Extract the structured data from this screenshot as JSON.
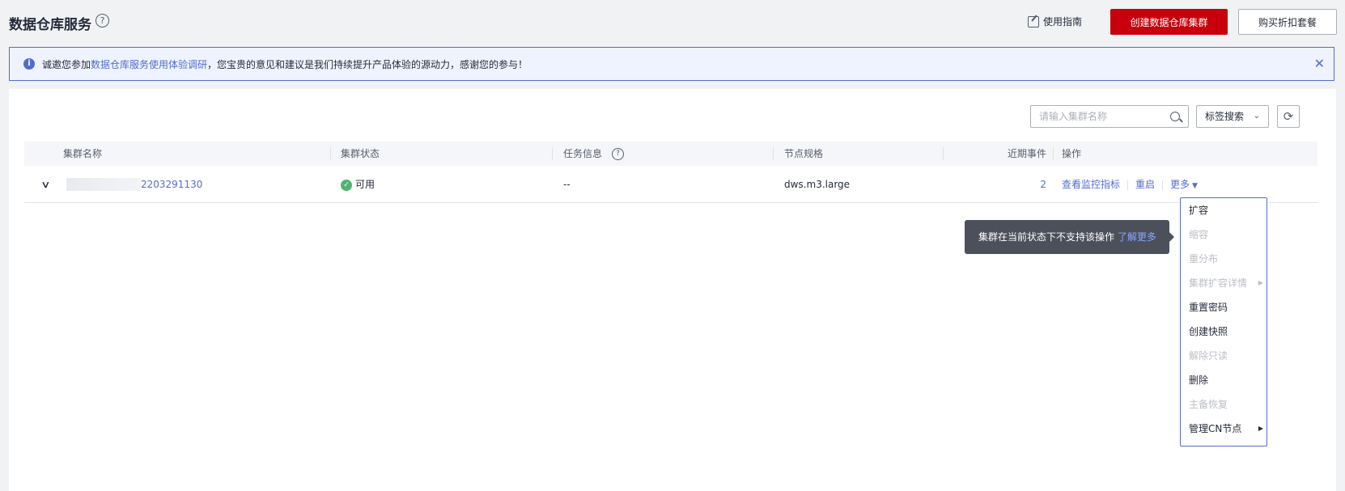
{
  "header": {
    "title": "数据仓库服务",
    "help_icon": "?",
    "guide_label": "使用指南",
    "create_button": "创建数据仓库集群",
    "buy_button": "购买折扣套餐"
  },
  "notice": {
    "prefix": "诚邀您参加",
    "link": "数据仓库服务使用体验调研",
    "suffix": "，您宝贵的意见和建议是我们持续提升产品体验的源动力，感谢您的参与！",
    "info_glyph": "i",
    "close_glyph": "✕"
  },
  "toolbar": {
    "search_placeholder": "请输入集群名称",
    "tag_search": "标签搜索",
    "tag_chevron": "⌄",
    "refresh_glyph": "⟳"
  },
  "table": {
    "headers": {
      "name": "集群名称",
      "status": "集群状态",
      "task": "任务信息",
      "task_help": "?",
      "spec": "节点规格",
      "events": "近期事件",
      "ops": "操作"
    },
    "rows": [
      {
        "expand": "∨",
        "name": "2203291130",
        "status": "可用",
        "status_glyph": "✓",
        "task": "--",
        "spec": "dws.m3.large",
        "events": "2",
        "op_monitor": "查看监控指标",
        "op_restart": "重启",
        "op_more": "更多",
        "more_caret": "▼"
      }
    ]
  },
  "tooltip": {
    "text": "集群在当前状态下不支持该操作",
    "link": "了解更多"
  },
  "more_menu": {
    "items": [
      {
        "label": "扩容",
        "disabled": false
      },
      {
        "label": "缩容",
        "disabled": true
      },
      {
        "label": "重分布",
        "disabled": true
      },
      {
        "label": "集群扩容详情",
        "disabled": true,
        "submenu": true
      },
      {
        "label": "重置密码",
        "disabled": false
      },
      {
        "label": "创建快照",
        "disabled": false
      },
      {
        "label": "解除只读",
        "disabled": true
      },
      {
        "label": "删除",
        "disabled": false
      },
      {
        "label": "主备恢复",
        "disabled": true
      },
      {
        "label": "管理CN节点",
        "disabled": false,
        "submenu": true
      }
    ],
    "submenu_glyph": "▶"
  },
  "colors": {
    "brand_red": "#c7000b",
    "link_blue": "#526ecc",
    "status_green": "#50b371",
    "tooltip_bg": "#4c505b"
  }
}
